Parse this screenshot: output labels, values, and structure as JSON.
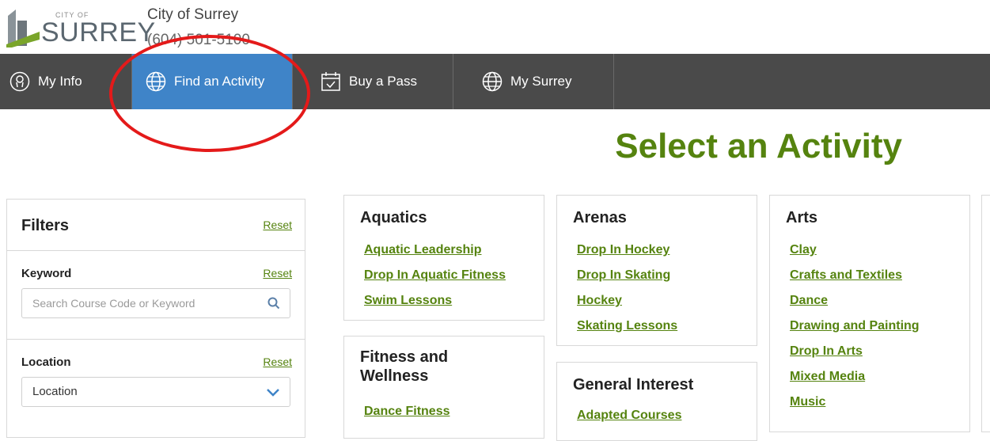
{
  "header": {
    "logo_small": "CITY OF",
    "logo_word": "SURREY",
    "org_name": "City of Surrey",
    "org_phone": "(604) 501-5100"
  },
  "nav": {
    "items": [
      {
        "label": "My Info",
        "icon": "user-icon"
      },
      {
        "label": "Find an Activity",
        "icon": "globe-icon",
        "active": true
      },
      {
        "label": "Buy a Pass",
        "icon": "calendar-icon"
      },
      {
        "label": "My Surrey",
        "icon": "globe-icon"
      }
    ]
  },
  "page_title": "Select an Activity",
  "filters": {
    "title": "Filters",
    "reset": "Reset",
    "keyword": {
      "label": "Keyword",
      "reset": "Reset",
      "placeholder": "Search Course Code or Keyword"
    },
    "location": {
      "label": "Location",
      "reset": "Reset",
      "value": "Location"
    }
  },
  "categories": [
    {
      "title": "Aquatics",
      "links": [
        "Aquatic Leadership",
        "Drop In Aquatic Fitness",
        "Swim Lessons"
      ]
    },
    {
      "title": "Fitness and Wellness",
      "links": [
        "Dance Fitness"
      ]
    },
    {
      "title": "Arenas",
      "links": [
        "Drop In Hockey",
        "Drop In Skating",
        "Hockey",
        "Skating Lessons"
      ]
    },
    {
      "title": "General Interest",
      "links": [
        "Adapted Courses"
      ]
    },
    {
      "title": "Arts",
      "links": [
        "Clay",
        "Crafts and Textiles",
        "Dance",
        "Drawing and Painting",
        "Drop In Arts",
        "Mixed Media",
        "Music"
      ]
    }
  ],
  "colors": {
    "accent_green": "#55830f",
    "nav_bg": "#4a4a4a",
    "nav_active": "#3f84c8",
    "annotation": "#e41a1a"
  }
}
